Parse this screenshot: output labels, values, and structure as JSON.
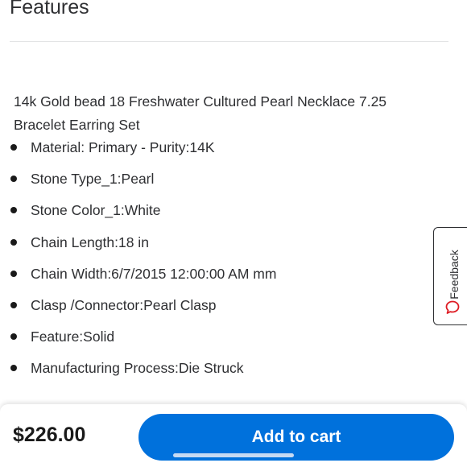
{
  "features": {
    "title": "Features",
    "description": "14k Gold bead 18 Freshwater Cultured Pearl Necklace 7.25 Bracelet Earring Set",
    "items": [
      {
        "text": "Material: Primary - Purity:14K"
      },
      {
        "text": "Stone Type_1:Pearl"
      },
      {
        "text": "Stone Color_1:White"
      },
      {
        "text": "Chain Length:18 in"
      },
      {
        "text": "Chain Width:6/7/2015 12:00:00 AM mm"
      },
      {
        "text": "Clasp /Connector:Pearl Clasp"
      },
      {
        "text": "Feature:Solid"
      },
      {
        "text": "Manufacturing Process:Die Struck"
      }
    ]
  },
  "feedback": {
    "label": "Feedback",
    "icon": "chat-bubble-icon",
    "icon_color": "#de1c24"
  },
  "bottom_bar": {
    "price": "$226.00",
    "add_to_cart_label": "Add to cart",
    "button_color": "#0071dc"
  }
}
